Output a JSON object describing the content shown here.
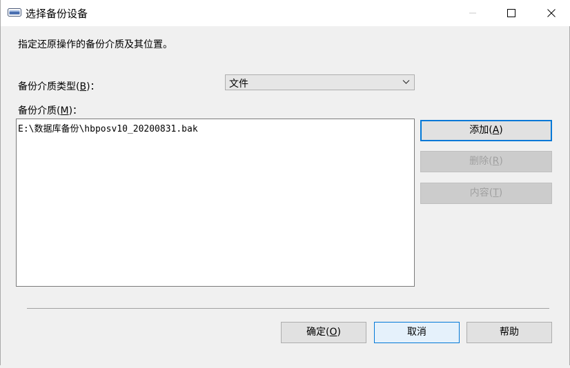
{
  "window": {
    "title": "选择备份设备",
    "icon": "device-window-icon"
  },
  "instruction": "指定还原操作的备份介质及其位置。",
  "media_type": {
    "label_pre": "备份介质类型(",
    "label_key": "B",
    "label_post": ")：",
    "selected": "文件"
  },
  "media": {
    "label_pre": "备份介质(",
    "label_key": "M",
    "label_post": ")：",
    "items": [
      "E:\\数据库备份\\hbposv10_20200831.bak"
    ]
  },
  "side_buttons": {
    "add": {
      "pre": "添加(",
      "key": "A",
      "post": ")"
    },
    "remove": {
      "pre": "删除(",
      "key": "R",
      "post": ")"
    },
    "content": {
      "pre": "内容(",
      "key": "T",
      "post": ")"
    }
  },
  "footer": {
    "ok": {
      "pre": "确定(",
      "key": "O",
      "post": ")"
    },
    "cancel": "取消",
    "help": "帮助"
  },
  "colors": {
    "accent": "#0078d7",
    "disabled_text": "#a0a0a0"
  }
}
